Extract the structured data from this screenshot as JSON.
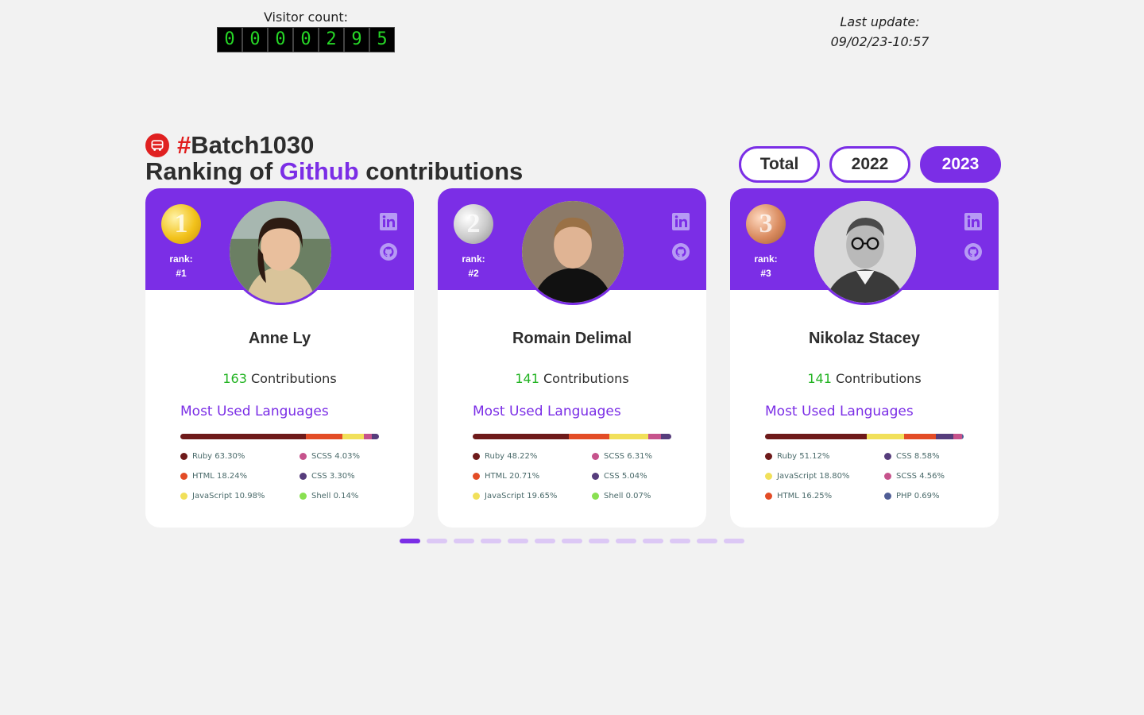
{
  "visitor": {
    "label": "Visitor count:",
    "digits": [
      "0",
      "0",
      "0",
      "0",
      "2",
      "9",
      "5"
    ]
  },
  "last_update": {
    "label": "Last update:",
    "value": "09/02/23-10:57"
  },
  "title": {
    "hash": "#",
    "batch": "Batch1030",
    "ranking_prefix": "Ranking of ",
    "github": "Github",
    "ranking_suffix": " contributions"
  },
  "tabs": [
    {
      "label": "Total"
    },
    {
      "label": "2022"
    },
    {
      "label": "2023",
      "active": true
    }
  ],
  "accent": "#7b2ee6",
  "cards": [
    {
      "medal_num": "1",
      "medal": "gold",
      "rank_label": "rank:",
      "rank": "#1",
      "name": "Anne Ly",
      "contrib_num": "163",
      "contrib_label": " Contributions",
      "mul": "Most Used Languages",
      "langs": [
        {
          "label": "Ruby 63.30%",
          "pct": 63.3,
          "color": "#6e1a1a"
        },
        {
          "label": "SCSS 4.03%",
          "pct": 4.03,
          "color": "#c6538c"
        },
        {
          "label": "HTML 18.24%",
          "pct": 18.24,
          "color": "#e34c26"
        },
        {
          "label": "CSS 3.30%",
          "pct": 3.3,
          "color": "#563d7c"
        },
        {
          "label": "JavaScript 10.98%",
          "pct": 10.98,
          "color": "#f1e05a"
        },
        {
          "label": "Shell 0.14%",
          "pct": 0.14,
          "color": "#89e051"
        }
      ],
      "bar_order": [
        0,
        2,
        4,
        1,
        3,
        5
      ]
    },
    {
      "medal_num": "2",
      "medal": "silver",
      "rank_label": "rank:",
      "rank": "#2",
      "name": "Romain Delimal",
      "contrib_num": "141",
      "contrib_label": " Contributions",
      "mul": "Most Used Languages",
      "langs": [
        {
          "label": "Ruby 48.22%",
          "pct": 48.22,
          "color": "#6e1a1a"
        },
        {
          "label": "SCSS 6.31%",
          "pct": 6.31,
          "color": "#c6538c"
        },
        {
          "label": "HTML 20.71%",
          "pct": 20.71,
          "color": "#e34c26"
        },
        {
          "label": "CSS 5.04%",
          "pct": 5.04,
          "color": "#563d7c"
        },
        {
          "label": "JavaScript 19.65%",
          "pct": 19.65,
          "color": "#f1e05a"
        },
        {
          "label": "Shell 0.07%",
          "pct": 0.07,
          "color": "#89e051"
        }
      ],
      "bar_order": [
        0,
        2,
        4,
        1,
        3,
        5
      ]
    },
    {
      "medal_num": "3",
      "medal": "bronze",
      "rank_label": "rank:",
      "rank": "#3",
      "name": "Nikolaz Stacey",
      "contrib_num": "141",
      "contrib_label": " Contributions",
      "mul": "Most Used Languages",
      "langs": [
        {
          "label": "Ruby 51.12%",
          "pct": 51.12,
          "color": "#6e1a1a"
        },
        {
          "label": "CSS 8.58%",
          "pct": 8.58,
          "color": "#563d7c"
        },
        {
          "label": "JavaScript 18.80%",
          "pct": 18.8,
          "color": "#f1e05a"
        },
        {
          "label": "SCSS 4.56%",
          "pct": 4.56,
          "color": "#c6538c"
        },
        {
          "label": "HTML 16.25%",
          "pct": 16.25,
          "color": "#e34c26"
        },
        {
          "label": "PHP 0.69%",
          "pct": 0.69,
          "color": "#4f5d95"
        }
      ],
      "bar_order": [
        0,
        2,
        4,
        1,
        3,
        5
      ]
    }
  ],
  "pagination": {
    "count": 13,
    "active": 0
  }
}
